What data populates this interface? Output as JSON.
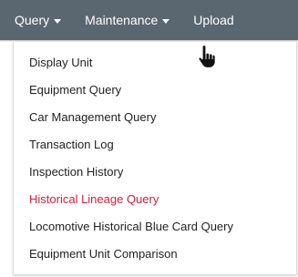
{
  "navbar": {
    "items": [
      {
        "label": "Query"
      },
      {
        "label": "Maintenance"
      },
      {
        "label": "Upload"
      }
    ]
  },
  "dropdown": {
    "items": [
      {
        "label": "Display Unit"
      },
      {
        "label": "Equipment Query"
      },
      {
        "label": "Car Management Query"
      },
      {
        "label": "Transaction Log"
      },
      {
        "label": "Inspection History"
      },
      {
        "label": "Historical Lineage Query"
      },
      {
        "label": "Locomotive Historical Blue Card Query"
      },
      {
        "label": "Equipment Unit Comparison"
      }
    ],
    "active_color": "#d81e3a"
  },
  "colors": {
    "navbar_bg": "#5a6670",
    "text": "#222222"
  }
}
